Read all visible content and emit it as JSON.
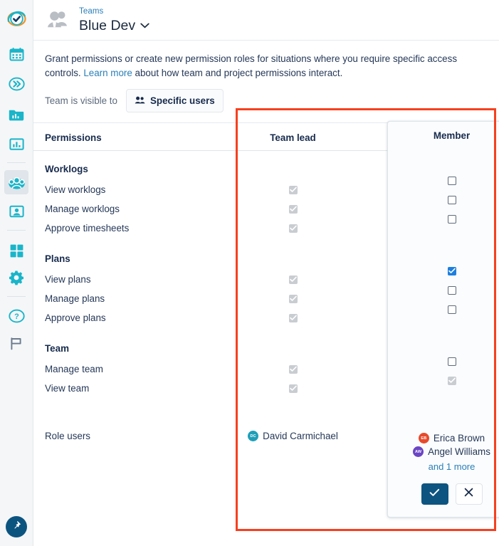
{
  "sidebar": {
    "items": [
      {
        "name": "app-logo-check-icon",
        "label": "Logo"
      },
      {
        "name": "calendar-icon",
        "label": "Calendar"
      },
      {
        "name": "double-chevron-right-icon",
        "label": "Expand"
      },
      {
        "name": "folder-chart-icon",
        "label": "Portfolio"
      },
      {
        "name": "bar-chart-icon",
        "label": "Reports"
      },
      {
        "name": "teams-icon",
        "label": "Teams"
      },
      {
        "name": "user-card-icon",
        "label": "People"
      },
      {
        "name": "apps-grid-icon",
        "label": "Apps"
      },
      {
        "name": "gear-icon",
        "label": "Settings"
      },
      {
        "name": "help-circle-icon",
        "label": "Help"
      },
      {
        "name": "flag-icon",
        "label": "Feedback"
      }
    ],
    "pin_label": "Pin sidebar"
  },
  "header": {
    "breadcrumb": "Teams",
    "title": "Blue Dev",
    "chevron": "chevron-down-icon"
  },
  "intro": {
    "text_before_link": "Grant permissions or create new permission roles for situations where you require specific access controls. ",
    "link_text": "Learn more",
    "text_after_link": " about how team and project permissions interact."
  },
  "visibility": {
    "label": "Team is visible to",
    "button_label": "Specific users"
  },
  "table": {
    "headers": {
      "permissions": "Permissions",
      "team_lead": "Team lead",
      "member": "Member"
    },
    "groups": [
      {
        "title": "Worklogs",
        "rows": [
          {
            "label": "View worklogs",
            "team_lead": "disabled-checked",
            "member": "empty"
          },
          {
            "label": "Manage worklogs",
            "team_lead": "disabled-checked",
            "member": "empty"
          },
          {
            "label": "Approve timesheets",
            "team_lead": "disabled-checked",
            "member": "empty"
          }
        ]
      },
      {
        "title": "Plans",
        "rows": [
          {
            "label": "View plans",
            "team_lead": "disabled-checked",
            "member": "checked"
          },
          {
            "label": "Manage plans",
            "team_lead": "disabled-checked",
            "member": "empty"
          },
          {
            "label": "Approve plans",
            "team_lead": "disabled-checked",
            "member": "empty"
          }
        ]
      },
      {
        "title": "Team",
        "rows": [
          {
            "label": "Manage team",
            "team_lead": "disabled-checked",
            "member": "empty"
          },
          {
            "label": "View team",
            "team_lead": "disabled-checked",
            "member": "disabled-checked"
          }
        ]
      }
    ],
    "role_users": {
      "label": "Role users",
      "team_lead_users": [
        {
          "initials": "DC",
          "name": "David Carmichael",
          "color": "#1e9fb8"
        }
      ],
      "member_users": [
        {
          "initials": "EB",
          "name": "Erica Brown",
          "color": "#e8492c"
        },
        {
          "initials": "AW",
          "name": "Angel Williams",
          "color": "#6b45c4"
        }
      ],
      "more_link": "and 1 more"
    }
  },
  "member_card": {
    "title": "Member",
    "confirm_label": "check-icon",
    "cancel_label": "close-icon"
  },
  "colors": {
    "accent_link": "#2a7fb8",
    "checkbox_checked": "#1d7fe0",
    "annotation": "#f6401f",
    "confirm_button": "#0d5480"
  }
}
